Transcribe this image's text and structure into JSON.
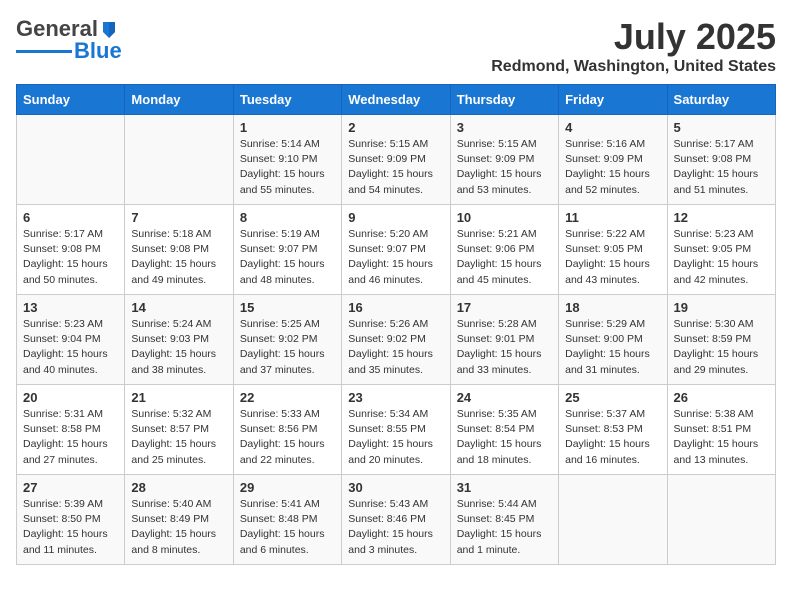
{
  "logo": {
    "general": "General",
    "blue": "Blue"
  },
  "title": "July 2025",
  "subtitle": "Redmond, Washington, United States",
  "weekdays": [
    "Sunday",
    "Monday",
    "Tuesday",
    "Wednesday",
    "Thursday",
    "Friday",
    "Saturday"
  ],
  "weeks": [
    [
      {
        "day": "",
        "info": ""
      },
      {
        "day": "",
        "info": ""
      },
      {
        "day": "1",
        "info": "Sunrise: 5:14 AM\nSunset: 9:10 PM\nDaylight: 15 hours\nand 55 minutes."
      },
      {
        "day": "2",
        "info": "Sunrise: 5:15 AM\nSunset: 9:09 PM\nDaylight: 15 hours\nand 54 minutes."
      },
      {
        "day": "3",
        "info": "Sunrise: 5:15 AM\nSunset: 9:09 PM\nDaylight: 15 hours\nand 53 minutes."
      },
      {
        "day": "4",
        "info": "Sunrise: 5:16 AM\nSunset: 9:09 PM\nDaylight: 15 hours\nand 52 minutes."
      },
      {
        "day": "5",
        "info": "Sunrise: 5:17 AM\nSunset: 9:08 PM\nDaylight: 15 hours\nand 51 minutes."
      }
    ],
    [
      {
        "day": "6",
        "info": "Sunrise: 5:17 AM\nSunset: 9:08 PM\nDaylight: 15 hours\nand 50 minutes."
      },
      {
        "day": "7",
        "info": "Sunrise: 5:18 AM\nSunset: 9:08 PM\nDaylight: 15 hours\nand 49 minutes."
      },
      {
        "day": "8",
        "info": "Sunrise: 5:19 AM\nSunset: 9:07 PM\nDaylight: 15 hours\nand 48 minutes."
      },
      {
        "day": "9",
        "info": "Sunrise: 5:20 AM\nSunset: 9:07 PM\nDaylight: 15 hours\nand 46 minutes."
      },
      {
        "day": "10",
        "info": "Sunrise: 5:21 AM\nSunset: 9:06 PM\nDaylight: 15 hours\nand 45 minutes."
      },
      {
        "day": "11",
        "info": "Sunrise: 5:22 AM\nSunset: 9:05 PM\nDaylight: 15 hours\nand 43 minutes."
      },
      {
        "day": "12",
        "info": "Sunrise: 5:23 AM\nSunset: 9:05 PM\nDaylight: 15 hours\nand 42 minutes."
      }
    ],
    [
      {
        "day": "13",
        "info": "Sunrise: 5:23 AM\nSunset: 9:04 PM\nDaylight: 15 hours\nand 40 minutes."
      },
      {
        "day": "14",
        "info": "Sunrise: 5:24 AM\nSunset: 9:03 PM\nDaylight: 15 hours\nand 38 minutes."
      },
      {
        "day": "15",
        "info": "Sunrise: 5:25 AM\nSunset: 9:02 PM\nDaylight: 15 hours\nand 37 minutes."
      },
      {
        "day": "16",
        "info": "Sunrise: 5:26 AM\nSunset: 9:02 PM\nDaylight: 15 hours\nand 35 minutes."
      },
      {
        "day": "17",
        "info": "Sunrise: 5:28 AM\nSunset: 9:01 PM\nDaylight: 15 hours\nand 33 minutes."
      },
      {
        "day": "18",
        "info": "Sunrise: 5:29 AM\nSunset: 9:00 PM\nDaylight: 15 hours\nand 31 minutes."
      },
      {
        "day": "19",
        "info": "Sunrise: 5:30 AM\nSunset: 8:59 PM\nDaylight: 15 hours\nand 29 minutes."
      }
    ],
    [
      {
        "day": "20",
        "info": "Sunrise: 5:31 AM\nSunset: 8:58 PM\nDaylight: 15 hours\nand 27 minutes."
      },
      {
        "day": "21",
        "info": "Sunrise: 5:32 AM\nSunset: 8:57 PM\nDaylight: 15 hours\nand 25 minutes."
      },
      {
        "day": "22",
        "info": "Sunrise: 5:33 AM\nSunset: 8:56 PM\nDaylight: 15 hours\nand 22 minutes."
      },
      {
        "day": "23",
        "info": "Sunrise: 5:34 AM\nSunset: 8:55 PM\nDaylight: 15 hours\nand 20 minutes."
      },
      {
        "day": "24",
        "info": "Sunrise: 5:35 AM\nSunset: 8:54 PM\nDaylight: 15 hours\nand 18 minutes."
      },
      {
        "day": "25",
        "info": "Sunrise: 5:37 AM\nSunset: 8:53 PM\nDaylight: 15 hours\nand 16 minutes."
      },
      {
        "day": "26",
        "info": "Sunrise: 5:38 AM\nSunset: 8:51 PM\nDaylight: 15 hours\nand 13 minutes."
      }
    ],
    [
      {
        "day": "27",
        "info": "Sunrise: 5:39 AM\nSunset: 8:50 PM\nDaylight: 15 hours\nand 11 minutes."
      },
      {
        "day": "28",
        "info": "Sunrise: 5:40 AM\nSunset: 8:49 PM\nDaylight: 15 hours\nand 8 minutes."
      },
      {
        "day": "29",
        "info": "Sunrise: 5:41 AM\nSunset: 8:48 PM\nDaylight: 15 hours\nand 6 minutes."
      },
      {
        "day": "30",
        "info": "Sunrise: 5:43 AM\nSunset: 8:46 PM\nDaylight: 15 hours\nand 3 minutes."
      },
      {
        "day": "31",
        "info": "Sunrise: 5:44 AM\nSunset: 8:45 PM\nDaylight: 15 hours\nand 1 minute."
      },
      {
        "day": "",
        "info": ""
      },
      {
        "day": "",
        "info": ""
      }
    ]
  ]
}
